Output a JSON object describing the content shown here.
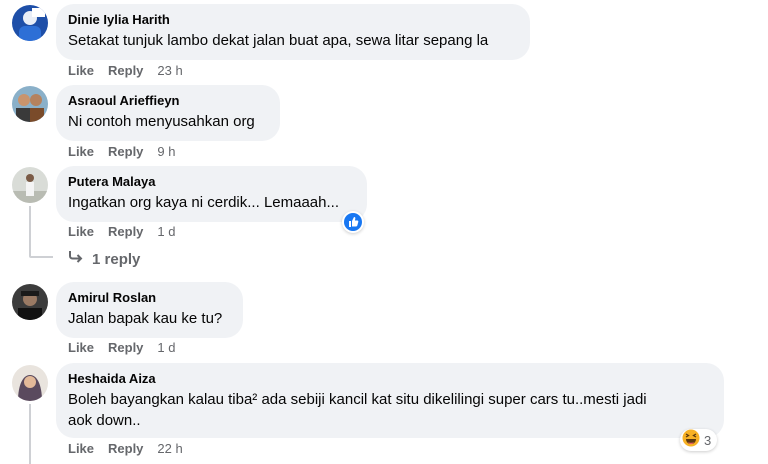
{
  "comments": [
    {
      "name": "Dinie Iylia Harith",
      "text": "Setakat tunjuk lambo dekat jalan buat apa, sewa litar sepang la",
      "time": "23 h"
    },
    {
      "name": "Asraoul Arieffieyn",
      "text": "Ni contoh menyusahkan org",
      "time": "9 h"
    },
    {
      "name": "Putera Malaya",
      "text": "Ingatkan org kaya ni cerdik... Lemaaah...",
      "time": "1 d",
      "reaction": "like",
      "replies": "1 reply"
    },
    {
      "name": "Amirul Roslan",
      "text": "Jalan bapak kau ke tu?",
      "time": "1 d"
    },
    {
      "name": "Heshaida Aiza",
      "text_line1": "Boleh bayangkan kalau tiba² ada sebiji kancil kat situ dikelilingi super cars tu..mesti jadi",
      "text_line2": "aok down..",
      "time": "22 h",
      "reaction": "haha",
      "reaction_count": "3"
    }
  ],
  "actions": {
    "like": "Like",
    "reply": "Reply"
  },
  "colors": {
    "bubble": "#f0f2f5",
    "meta": "#65676b",
    "like_blue": "#1877f2",
    "haha_yellow": "#f7b125"
  }
}
